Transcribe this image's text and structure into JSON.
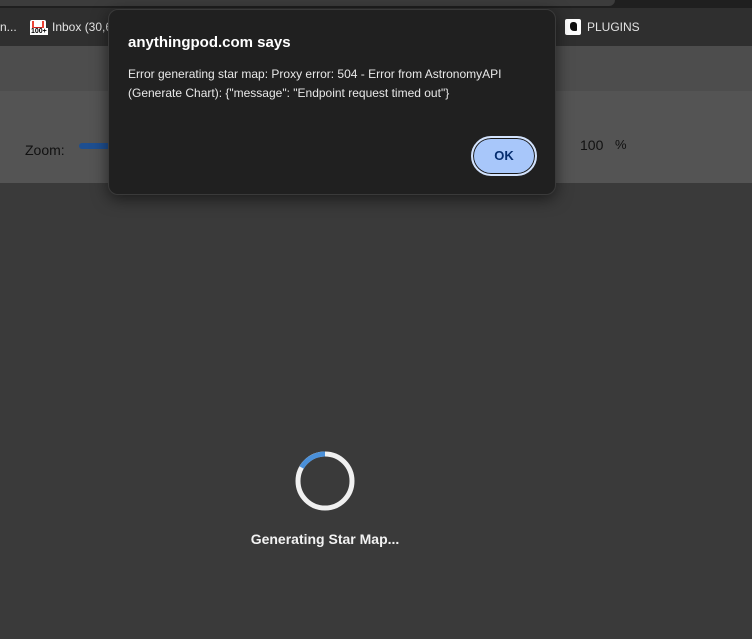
{
  "bookmarks": {
    "left_item": "n...",
    "inbox_label": "Inbox (30,6",
    "inbox_icon": "gmail-icon",
    "plugins_label": "PLUGINS",
    "plugins_icon": "plugin-icon"
  },
  "toolbar": {
    "zoom_label": "Zoom:",
    "zoom_value": "100",
    "zoom_unit": "%"
  },
  "loading": {
    "text": "Generating Star Map...",
    "spinner_color": "#4a90d9"
  },
  "dialog": {
    "title": "anythingpod.com says",
    "message": "Error generating star map: Proxy error: 504  - Error from AstronomyAPI (Generate Chart): {\"message\": \"Endpoint request timed out\"}",
    "ok_label": "OK",
    "accent": "#a8c7fa"
  }
}
